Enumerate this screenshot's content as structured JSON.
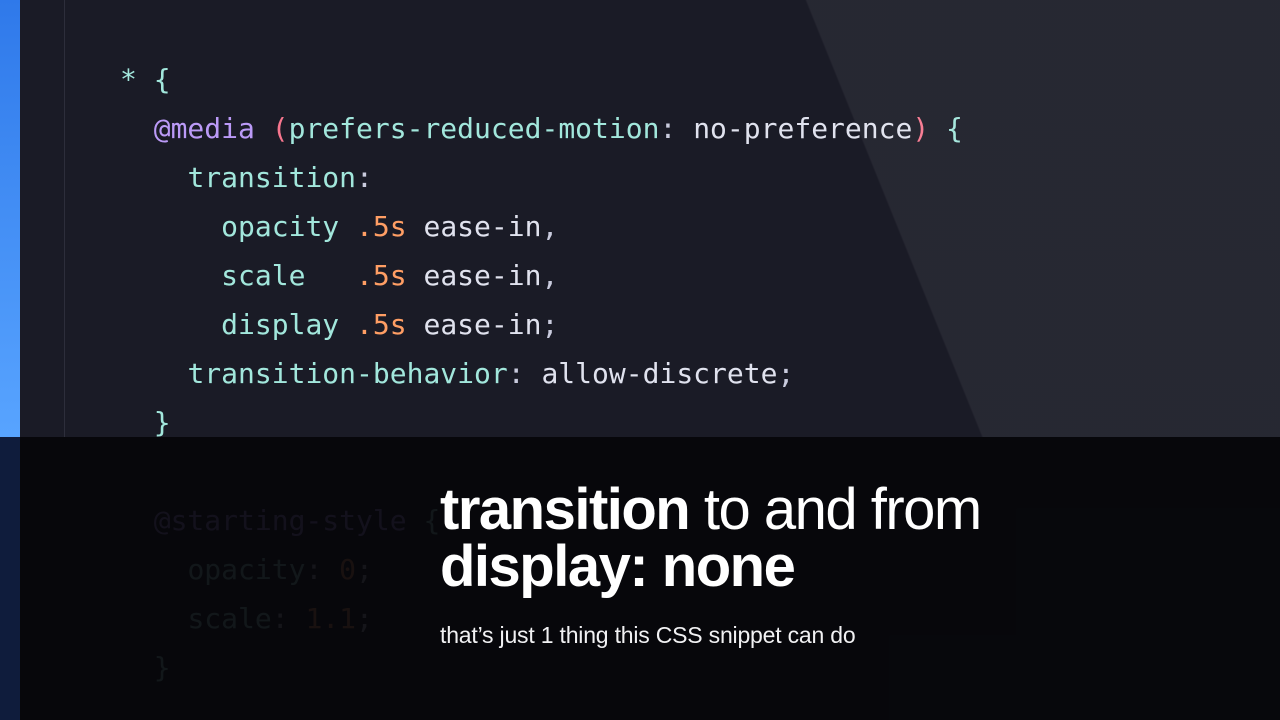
{
  "code": {
    "line1": {
      "sel": "*",
      "brace": " {"
    },
    "line2": {
      "at": "@media",
      "lparen": " (",
      "feat": "prefers-reduced-motion",
      "colon": ": ",
      "val": "no-preference",
      "rparen": ")",
      "brace": " {"
    },
    "line3": {
      "prop": "transition",
      "colon": ":"
    },
    "line4": {
      "prop": "opacity",
      "dur": " .5s",
      "ease": " ease-in",
      "comma": ","
    },
    "line5": {
      "prop": "scale",
      "pad": "  ",
      "dur": " .5s",
      "ease": " ease-in",
      "comma": ","
    },
    "line6": {
      "prop": "display",
      "dur": " .5s",
      "ease": " ease-in",
      "semi": ";"
    },
    "line7": {
      "prop": "transition-behavior",
      "colon": ": ",
      "val": "allow-discrete",
      "semi": ";"
    },
    "line8": {
      "brace": "}"
    },
    "line9": "",
    "line10": {
      "at": "@starting-style",
      "brace": " {"
    },
    "line11": {
      "prop": "opacity",
      "colon": ": ",
      "val": "0",
      "semi": ";"
    },
    "line12": {
      "prop": "scale",
      "colon": ": ",
      "val": "1.1",
      "semi": ";"
    },
    "line13": {
      "brace": "}"
    }
  },
  "headline": {
    "l1_strong": "transition",
    "l1_rest": " to and from",
    "l2": "display: none",
    "sub": "that’s just 1 thing this CSS snippet can do"
  },
  "colors": {
    "accent_top": "#2f79ea",
    "accent_bottom": "#58a4ff",
    "editor_bg": "#1a1b26",
    "keyword": "#bb9af7",
    "property": "#a2e7dc",
    "number": "#ff9e64",
    "paren": "#f7768e"
  }
}
